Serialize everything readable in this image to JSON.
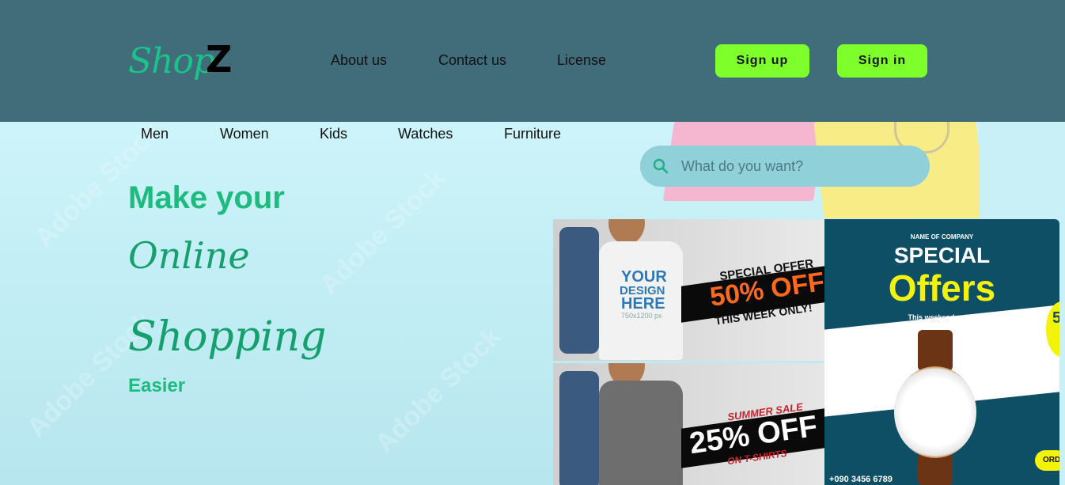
{
  "header": {
    "logo_script": "Shop",
    "logo_letter": "Z",
    "nav": [
      "About us",
      "Contact us",
      "License"
    ],
    "signup_label": "Sign up",
    "signin_label": "Sign in"
  },
  "categories": [
    "Men",
    "Women",
    "Kids",
    "Watches",
    "Furniture"
  ],
  "search": {
    "placeholder": "What do you want?"
  },
  "hero": {
    "line1": "Make your",
    "line2": "Online",
    "line3": "Shopping",
    "line4": "Easier"
  },
  "promos": {
    "p1": {
      "shirt_text_1": "YOUR",
      "shirt_text_2": "DESIGN",
      "shirt_text_3": "HERE",
      "shirt_size": "750x1200 px",
      "offer_top": "SPECIAL OFFER",
      "offer_main": "50% OFF",
      "offer_bottom": "THIS WEEK ONLY!"
    },
    "p2": {
      "offer_top": "SUMMER SALE",
      "offer_main": "25% OFF",
      "offer_bottom": "ON T-SHIRTS"
    },
    "p3": {
      "company": "NAME OF COMPANY",
      "title1": "SPECIAL",
      "title2": "Offers",
      "subtitle": "This weekend only!!",
      "phone": "+090 3456 6789",
      "order": "ORD",
      "side": "5"
    }
  },
  "colors": {
    "header_bg": "#416d7a",
    "accent_green": "#1dbb7e",
    "button_bg": "#7eff2b",
    "search_bg": "#8fd0d9"
  }
}
